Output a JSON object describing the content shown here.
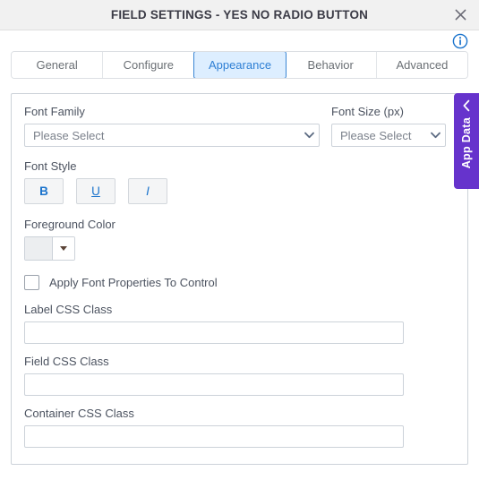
{
  "titlebar": {
    "title": "FIELD SETTINGS - YES NO RADIO BUTTON",
    "close_icon": "close-icon"
  },
  "header": {
    "info_icon": "info-icon"
  },
  "tabs": [
    {
      "label": "General",
      "active": false
    },
    {
      "label": "Configure",
      "active": false
    },
    {
      "label": "Appearance",
      "active": true
    },
    {
      "label": "Behavior",
      "active": false
    },
    {
      "label": "Advanced",
      "active": false
    }
  ],
  "form": {
    "font_family": {
      "label": "Font Family",
      "value": "Please Select"
    },
    "font_size": {
      "label": "Font Size (px)",
      "value": "Please Select"
    },
    "font_style": {
      "label": "Font Style",
      "buttons": [
        {
          "label": "B",
          "name": "bold-button"
        },
        {
          "label": "U",
          "name": "underline-button"
        },
        {
          "label": "I",
          "name": "italic-button"
        }
      ]
    },
    "foreground_color": {
      "label": "Foreground Color",
      "swatch_color": "#eceef0"
    },
    "apply_font_properties": {
      "label": "Apply Font Properties To Control",
      "checked": false
    },
    "label_css_class": {
      "label": "Label CSS Class",
      "value": "",
      "placeholder": ""
    },
    "field_css_class": {
      "label": "Field CSS Class",
      "value": "",
      "placeholder": ""
    },
    "container_css_class": {
      "label": "Container CSS Class",
      "value": "",
      "placeholder": ""
    }
  },
  "app_data_panel": {
    "label": "App Data",
    "chevron_icon": "chevron-left-icon",
    "color": "#6633cc"
  },
  "colors": {
    "accent_blue": "#2e7fd4",
    "active_tab_bg": "#ddeeff",
    "titlebar_bg": "#f1f1f1",
    "purple": "#6633cc",
    "style_btn_text": "#1a73cc"
  }
}
